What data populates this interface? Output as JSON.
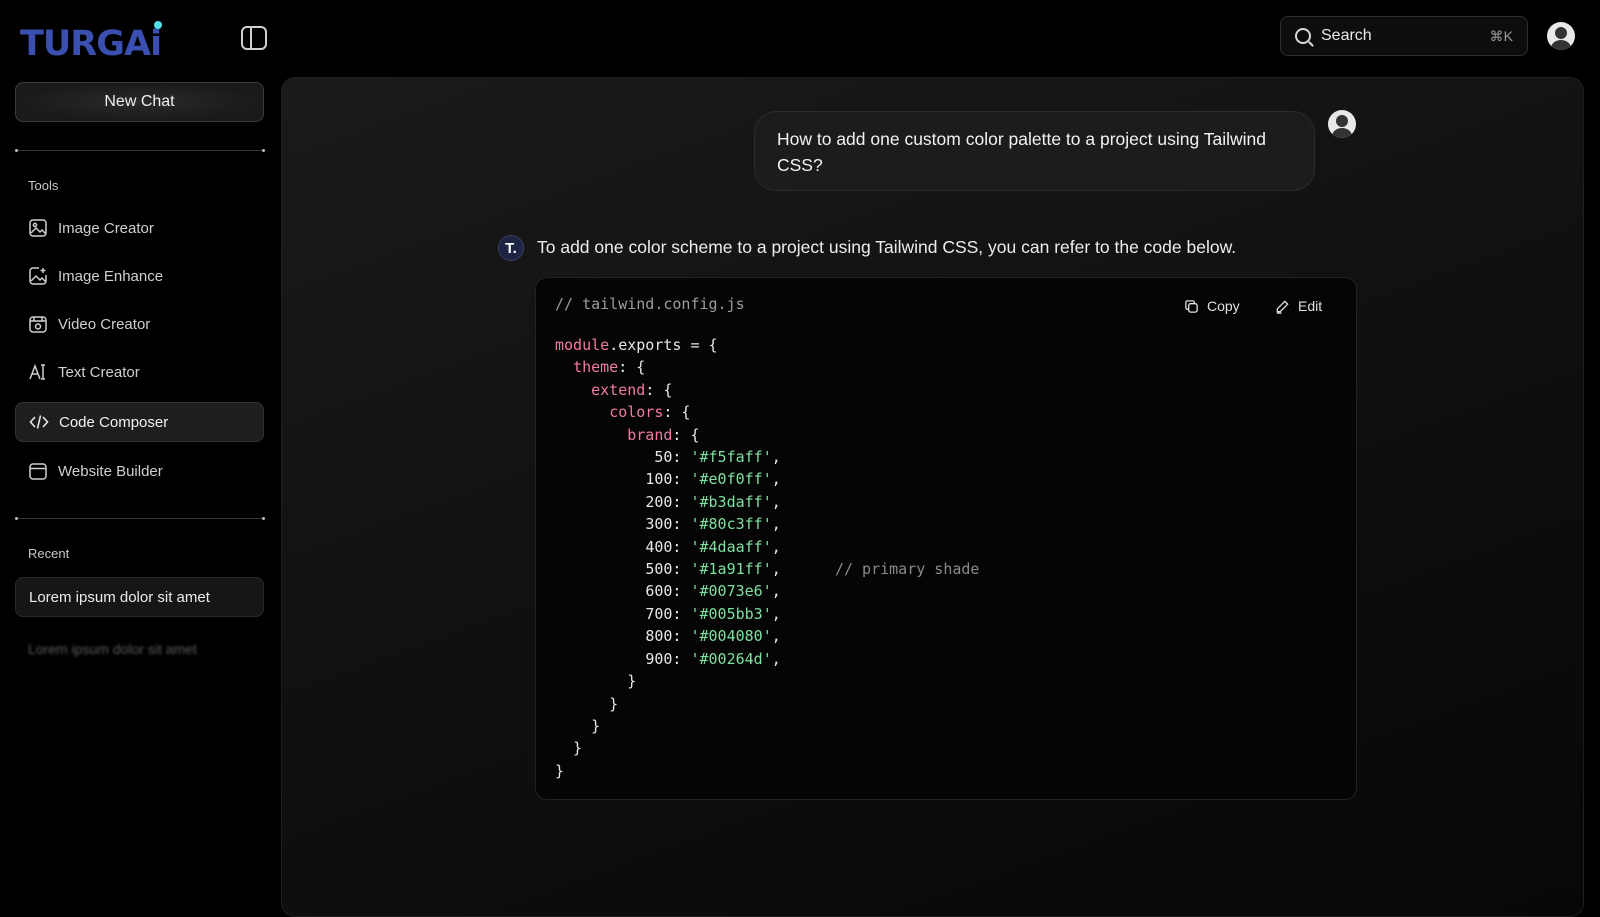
{
  "header": {
    "logo_text": "TURGAi",
    "search": {
      "label": "Search",
      "shortcut": "⌘K"
    }
  },
  "sidebar": {
    "new_chat_label": "New Chat",
    "tools_label": "Tools",
    "tools": [
      {
        "label": "Image Creator",
        "icon": "image-icon"
      },
      {
        "label": "Image Enhance",
        "icon": "image-enhance-icon"
      },
      {
        "label": "Video Creator",
        "icon": "video-icon"
      },
      {
        "label": "Text Creator",
        "icon": "text-icon"
      },
      {
        "label": "Code Composer",
        "icon": "code-icon",
        "active": true
      },
      {
        "label": "Website Builder",
        "icon": "browser-icon"
      }
    ],
    "recent_label": "Recent",
    "recent": [
      {
        "label": "Lorem ipsum dolor sit amet"
      },
      {
        "label": "Lorem ipsum dolor sit amet",
        "faded": true
      }
    ]
  },
  "chat": {
    "user_message": "How to add one custom color palette to a project using Tailwind CSS?",
    "bot_badge": "T.",
    "bot_message": "To add one color scheme to a project using Tailwind CSS, you can refer to the code below.",
    "code": {
      "filename": "// tailwind.config.js",
      "copy_label": "Copy",
      "edit_label": "Edit",
      "module": "module",
      "exports_open": ".exports = {",
      "theme_key": "theme",
      "extend_key": "extend",
      "colors_key": "colors",
      "brand_key": "brand",
      "shades": [
        {
          "key": "50",
          "value": "'#f5faff'"
        },
        {
          "key": "100",
          "value": "'#e0f0ff'"
        },
        {
          "key": "200",
          "value": "'#b3daff'"
        },
        {
          "key": "300",
          "value": "'#80c3ff'"
        },
        {
          "key": "400",
          "value": "'#4daaff'"
        },
        {
          "key": "500",
          "value": "'#1a91ff'",
          "comment": "// primary shade"
        },
        {
          "key": "600",
          "value": "'#0073e6'"
        },
        {
          "key": "700",
          "value": "'#005bb3'"
        },
        {
          "key": "800",
          "value": "'#004080'"
        },
        {
          "key": "900",
          "value": "'#00264d'"
        }
      ]
    }
  },
  "colors": {
    "background": "#000000",
    "panel": "#141414",
    "logo": "#3a4fb0",
    "logo_dot": "#4fe0e8",
    "code_keyword": "#f07aa7",
    "code_string": "#7ee0a0"
  }
}
